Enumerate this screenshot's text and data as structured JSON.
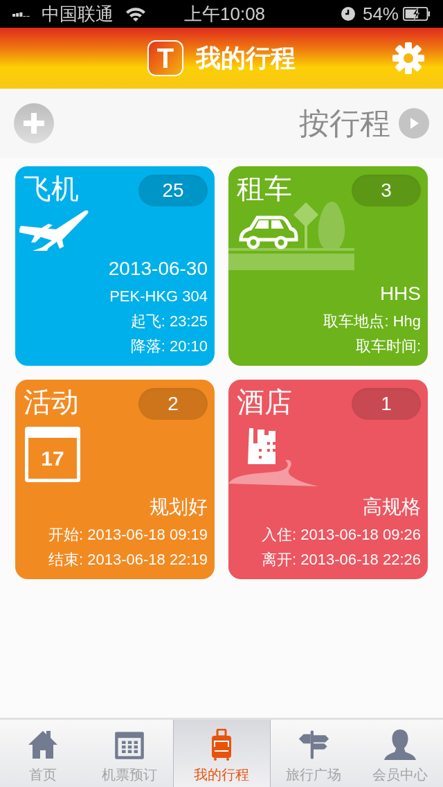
{
  "status_bar": {
    "carrier": "中国联通",
    "time": "上午10:08",
    "battery": "54%"
  },
  "header": {
    "logo": "T",
    "title": "我的行程"
  },
  "toolbar": {
    "sort_label": "按行程"
  },
  "cards": [
    {
      "kind": "flight",
      "color": "#00b0ea",
      "title": "飞机",
      "count": "25",
      "headline": "2013-06-30",
      "details": [
        "PEK-HKG 304",
        "起飞: 23:25",
        "降落: 20:10"
      ]
    },
    {
      "kind": "car",
      "color": "#6db31b",
      "title": "租车",
      "count": "3",
      "headline": "HHS",
      "details": [
        "取车地点: Hhg",
        "取车时间:"
      ]
    },
    {
      "kind": "activity",
      "color": "#f28a22",
      "title": "活动",
      "count": "2",
      "icon_text": "17",
      "headline": "规划好",
      "details": [
        "开始: 2013-06-18 09:19",
        "结束: 2013-06-18 22:19"
      ]
    },
    {
      "kind": "hotel",
      "color": "#ec5660",
      "title": "酒店",
      "count": "1",
      "headline": "高规格",
      "details": [
        "入住: 2013-06-18 09:26",
        "离开: 2013-06-18 22:26"
      ]
    }
  ],
  "tab_bar": [
    {
      "kind": "home",
      "label": "首页",
      "selected": false
    },
    {
      "kind": "tickets",
      "label": "机票预订",
      "selected": false
    },
    {
      "kind": "trips",
      "label": "我的行程",
      "selected": true
    },
    {
      "kind": "plaza",
      "label": "旅行广场",
      "selected": false
    },
    {
      "kind": "member",
      "label": "会员中心",
      "selected": false
    }
  ]
}
